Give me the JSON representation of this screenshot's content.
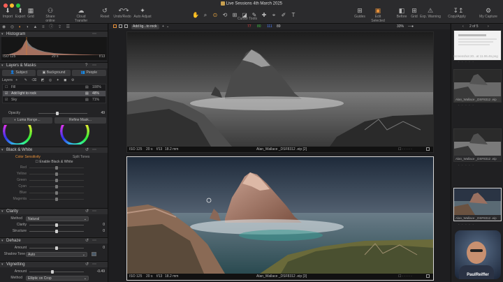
{
  "window": {
    "title": "Live Sessions 4th March 2025"
  },
  "toolbar": {
    "left": [
      {
        "label": "Import",
        "icon": "import-icon"
      },
      {
        "label": "Export",
        "icon": "export-icon"
      },
      {
        "label": "Grid",
        "icon": "grid-icon"
      },
      {
        "label": "Share online",
        "icon": "share-icon"
      },
      {
        "label": "Cloud Transfer",
        "icon": "cloud-icon"
      },
      {
        "label": "Reset",
        "icon": "reset-icon"
      },
      {
        "label": "Undo/Redo",
        "icon": "undo-icon"
      },
      {
        "label": "Auto Adjust",
        "icon": "wand-icon"
      }
    ],
    "cursor_tools_label": "Cursor Tools",
    "right": [
      {
        "label": "Guides",
        "icon": "guides-icon"
      },
      {
        "label": "Edit Selected",
        "icon": "edit-selected-icon"
      },
      {
        "label": "Before",
        "icon": "before-icon"
      },
      {
        "label": "Grid",
        "icon": "grid2-icon"
      },
      {
        "label": "Exp. Warning",
        "icon": "warning-icon"
      },
      {
        "label": "Copy/Apply",
        "icon": "copy-apply-icon"
      },
      {
        "label": "My Capture",
        "icon": "capture-icon"
      }
    ]
  },
  "stats": {
    "r": "77",
    "g": "80",
    "b": "111",
    "l": "89"
  },
  "viewer_bar": {
    "layer_dropdown": "Add lig...to rock",
    "zoom": "33%",
    "page": "2 of 5"
  },
  "histogram": {
    "title": "Histogram",
    "iso": "ISO 125",
    "shutter": "20 s",
    "aperture": "f/13"
  },
  "layers": {
    "title": "Layers & Masks",
    "tabs": [
      "Subject",
      "Background",
      "People"
    ],
    "label": "Layers",
    "items": [
      {
        "name": "Fill",
        "opacity": "100%"
      },
      {
        "name": "Add light to rock",
        "opacity": "48%"
      },
      {
        "name": "Sky",
        "opacity": "71%"
      }
    ],
    "opacity_label": "Opacity",
    "opacity_value": "49",
    "luma_button": "Luma Range...",
    "refine_button": "Refine Mask..."
  },
  "bw": {
    "title": "Black & White",
    "tab_active": "Color Sensitivity",
    "tab_other": "Split Tones",
    "enable": "Enable Black & White",
    "channels": [
      "Red",
      "Yellow",
      "Green",
      "Cyan",
      "Blue",
      "Magenta"
    ]
  },
  "clarity": {
    "title": "Clarity",
    "method_label": "Method",
    "method_value": "Natural",
    "rows": [
      {
        "label": "Clarity",
        "value": "0"
      },
      {
        "label": "Structure",
        "value": "0"
      }
    ]
  },
  "dehaze": {
    "title": "Dehaze",
    "amount_label": "Amount",
    "amount_value": "0",
    "shadow_label": "Shadow Tone",
    "shadow_value": "Auto"
  },
  "vignetting": {
    "title": "Vignetting",
    "amount_label": "Amount",
    "amount_value": "-0.49",
    "method_label": "Method",
    "method_value": "Elliptic on Crop"
  },
  "viewers": [
    {
      "iso": "ISO 125",
      "shutter": "20 s",
      "aperture": "f/13",
      "focal": "18.2 mm",
      "file": "Alan_Wallace _DSF8312 .eip [2]"
    },
    {
      "iso": "ISO 125",
      "shutter": "20 s",
      "aperture": "f/13",
      "focal": "18.2 mm",
      "file": "Alan_Wallace _DSF8312 .eip [3]"
    }
  ],
  "browser": {
    "thumbs": [
      {
        "caption": "Screenshot 20...at 11.06.46.png"
      },
      {
        "caption": "Alan_Wallace _DSF8312 .eip"
      },
      {
        "caption": "Alan_Wallace _DSF8312 .eip"
      },
      {
        "caption": "Alan_Wallace _DSF8312 .eip"
      }
    ]
  },
  "webcam": {
    "name": "PaulReiffer"
  }
}
